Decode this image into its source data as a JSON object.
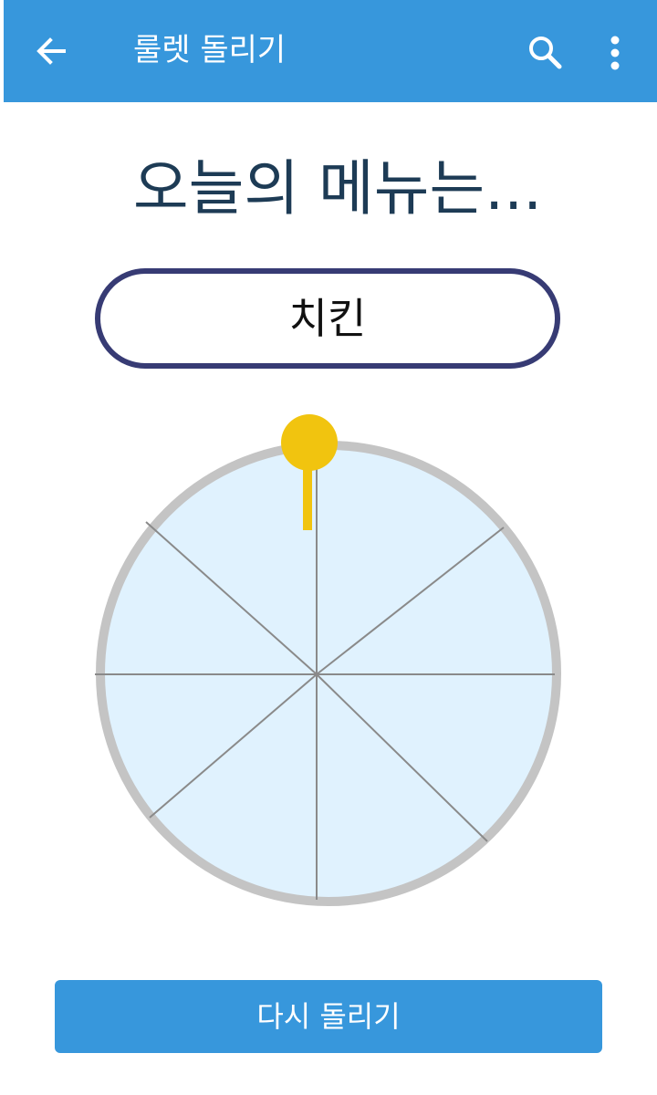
{
  "app_bar": {
    "title": "룰렛 돌리기",
    "back_icon": "arrow-left-icon",
    "search_icon": "search-icon",
    "more_icon": "more-vertical-icon",
    "background_color": "#3797DC"
  },
  "main": {
    "headline": "오늘의 메뉴는...",
    "result": "치킨"
  },
  "wheel": {
    "segment_count": 8,
    "fill_color": "#E0F2FE",
    "rim_color": "#C4C4C4",
    "divider_color": "#8A8A8A",
    "pointer_color": "#F1C40F"
  },
  "actions": {
    "spin_again_label": "다시 돌리기"
  }
}
